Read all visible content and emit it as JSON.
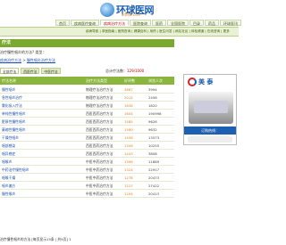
{
  "header": {
    "logo_title": "环球医网",
    "logo_url": "54MD.com"
  },
  "nav": {
    "items": [
      "首页",
      "疾病医疗查询",
      "疾病治疗方法",
      "医院查询",
      "医药",
      "全国医院",
      "目录",
      "药品",
      "环球医讯"
    ],
    "active_index": 2
  },
  "subnav": {
    "text": "疾病导航 | 求医指南 | 医院查询 | 健康百科 | 用药 | 医生问答 | 病友社区 | 体检频道 | 在线咨询 | 更多"
  },
  "section": {
    "title": "疗法"
  },
  "search": {
    "text": "治疗慢性咽炎的方法? 类型："
  },
  "breadcrumb": {
    "prefix": "",
    "link1": "疾病治疗方法",
    "sep": " > ",
    "link2": "慢性咽炎治疗方法"
  },
  "tabs": {
    "items": [
      "全部疗法",
      "西医疗法",
      "中医疗法"
    ],
    "active_index": 0
  },
  "total": {
    "label": "总计疗法数：",
    "value": "129/1000"
  },
  "table": {
    "headers": [
      "疗法名称",
      "治疗方法类型",
      "好评数",
      "浏览人次"
    ],
    "rows": [
      {
        "name": "慢性咽炎",
        "type": "物理疗法治疗方法",
        "rating": "3887",
        "views": "3994"
      },
      {
        "name": "急性咽炎治疗",
        "type": "物理疗法治疗方法",
        "rating": "2015",
        "views": "2456"
      },
      {
        "name": "雾化吸入疗法",
        "type": "物理疗法治疗方法",
        "rating": "1838",
        "views": "1820"
      },
      {
        "name": "单纯性慢性咽炎",
        "type": "西医西药治疗方法",
        "rating": "1604",
        "views": "190998"
      },
      {
        "name": "肥厚性慢性咽炎",
        "type": "西医西药治疗方法",
        "rating": "1585",
        "views": "9626"
      },
      {
        "name": "萎缩性慢性咽炎",
        "type": "西医西药治疗方法",
        "rating": "1560",
        "views": "9632"
      },
      {
        "name": "干燥性咽炎",
        "type": "西医西药治疗方法",
        "rating": "1558",
        "views": "13573"
      },
      {
        "name": "咽部感染",
        "type": "西医西药治疗方法",
        "rating": "1508",
        "views": "10255"
      },
      {
        "name": "咽异感症",
        "type": "西医西药治疗方法",
        "rating": "1443",
        "views": "3808"
      },
      {
        "name": "咽喉炎",
        "type": "中医中药治疗方法",
        "rating": "1398",
        "views": "11889"
      },
      {
        "name": "中药治疗慢性咽炎",
        "type": "中医中药治疗方法",
        "rating": "1324",
        "views": "22917"
      },
      {
        "name": "咽喉干燥",
        "type": "中医中药治疗方法",
        "rating": "1278",
        "views": "20473"
      },
      {
        "name": "咽炎偏方",
        "type": "中医中药治疗方法",
        "rating": "1227",
        "views": "27422"
      },
      {
        "name": "慢性喉炎",
        "type": "中医中药治疗方法",
        "rating": "1204",
        "views": "20413"
      }
    ]
  },
  "pager": {
    "text": "治疗慢性咽炎的方法 [每页显示15条 | 共9页]  1"
  },
  "ad": {
    "brand": "美 泰",
    "phone": "订购热线："
  }
}
